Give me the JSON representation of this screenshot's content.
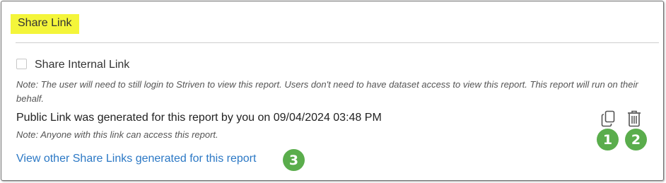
{
  "panel": {
    "title": "Share Link",
    "internal_link": {
      "label": "Share Internal Link",
      "checked": false,
      "note": "Note: The user will need to still login to Striven to view this report. Users don't need to have dataset access to view this report. This report will run on their behalf."
    },
    "public_link": {
      "text": "Public Link was generated for this report by you on 09/04/2024 03:48 PM",
      "note": "Note: Anyone with this link can access this report."
    },
    "view_other_link": "View other Share Links generated for this report",
    "icons": {
      "copy": "copy-icon",
      "delete": "trash-icon"
    },
    "callouts": [
      "1",
      "2",
      "3"
    ]
  },
  "colors": {
    "title_highlight": "#f4f53a",
    "link": "#2b78c5",
    "callout": "#5aad4c"
  }
}
